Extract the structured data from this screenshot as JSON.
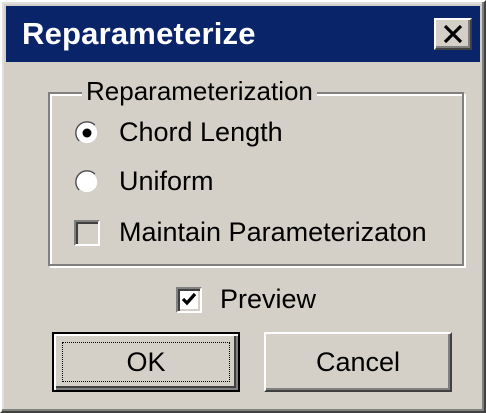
{
  "window": {
    "title": "Reparameterize",
    "close_icon": "close-icon"
  },
  "group": {
    "label": "Reparameterization",
    "options": [
      {
        "label": "Chord Length",
        "type": "radio",
        "selected": true
      },
      {
        "label": "Uniform",
        "type": "radio",
        "selected": false
      },
      {
        "label": "Maintain Parameterizaton",
        "type": "checkbox",
        "checked": false,
        "enabled": false
      }
    ]
  },
  "preview": {
    "label": "Preview",
    "checked": true
  },
  "buttons": {
    "ok_label": "OK",
    "cancel_label": "Cancel"
  },
  "colors": {
    "titlebar": "#0a246a",
    "face": "#d4d0c8"
  }
}
